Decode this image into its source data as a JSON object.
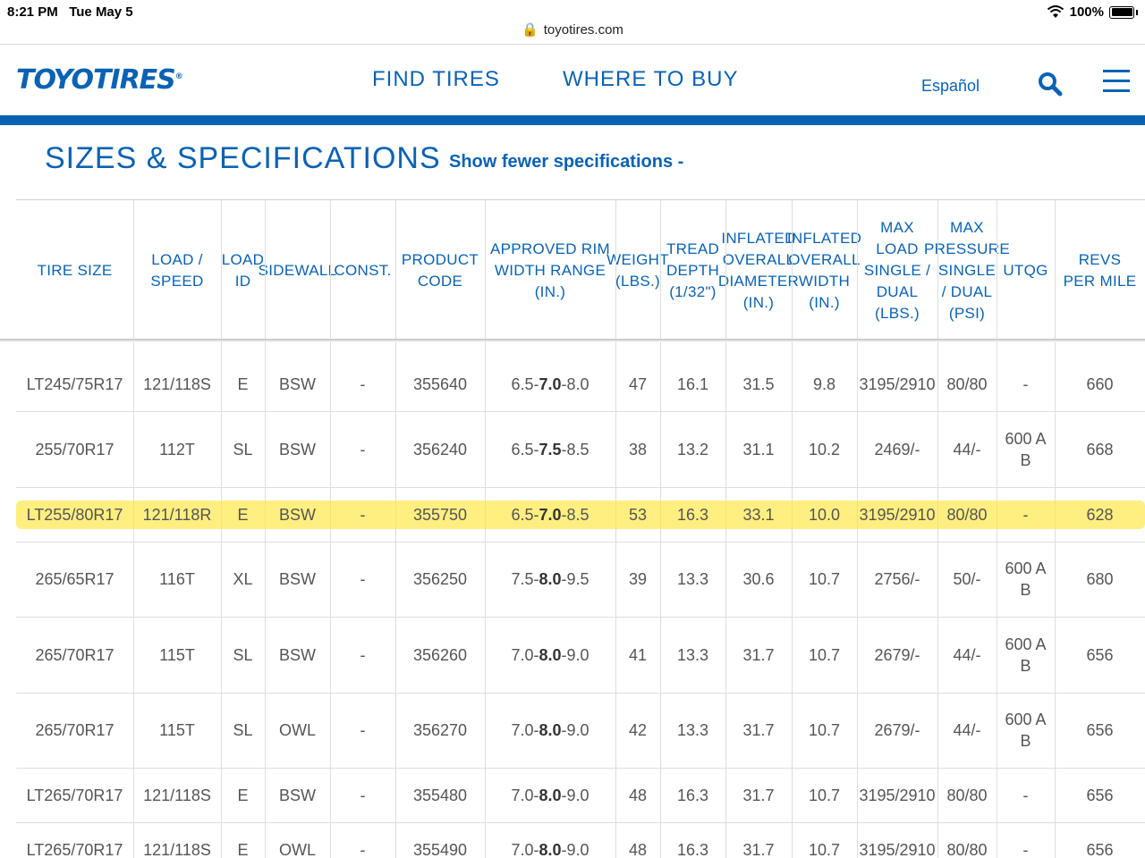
{
  "status": {
    "time": "8:21 PM",
    "date": "Tue May 5",
    "battery": "100%",
    "url": "toyotires.com"
  },
  "header": {
    "logo": "TOYOTIRES",
    "logo_mark": "®",
    "nav": [
      "FIND TIRES",
      "WHERE TO BUY"
    ],
    "espanol": "Español"
  },
  "section": {
    "title": "SIZES & SPECIFICATIONS",
    "toggle": "Show fewer specifications -"
  },
  "columns": [
    "TIRE SIZE",
    "LOAD / SPEED",
    "LOAD ID",
    "SIDEWALL",
    "CONST.",
    "PRODUCT CODE",
    "APPROVED RIM WIDTH RANGE (IN.)",
    "WEIGHT (LBS.)",
    "TREAD DEPTH (1/32\")",
    "INFLATED OVERALL DIAMETER (IN.)",
    "INFLATED OVERALL WIDTH (IN.)",
    "MAX LOAD SINGLE / DUAL (LBS.)",
    "MAX PRESSURE SINGLE / DUAL (PSI)",
    "UTQG",
    "REVS PER MILE"
  ],
  "rows": [
    {
      "size": "LT245/75R17",
      "load": "121/118S",
      "id": "E",
      "sidewall": "BSW",
      "const": "-",
      "code": "355640",
      "rim": [
        "6.5-",
        "7.0",
        "-8.0"
      ],
      "weight": "47",
      "tread": "16.1",
      "dia": "31.5",
      "width": "9.8",
      "maxload": "3195/2910",
      "psi": "80/80",
      "utqg": "-",
      "revs": "660"
    },
    {
      "size": "255/70R17",
      "load": "112T",
      "id": "SL",
      "sidewall": "BSW",
      "const": "-",
      "code": "356240",
      "rim": [
        "6.5-",
        "7.5",
        "-8.5"
      ],
      "weight": "38",
      "tread": "13.2",
      "dia": "31.1",
      "width": "10.2",
      "maxload": "2469/-",
      "psi": "44/-",
      "utqg": "600 A B",
      "revs": "668"
    },
    {
      "size": "LT255/80R17",
      "load": "121/118R",
      "id": "E",
      "sidewall": "BSW",
      "const": "-",
      "code": "355750",
      "rim": [
        "6.5-",
        "7.0",
        "-8.5"
      ],
      "weight": "53",
      "tread": "16.3",
      "dia": "33.1",
      "width": "10.0",
      "maxload": "3195/2910",
      "psi": "80/80",
      "utqg": "-",
      "revs": "628",
      "highlighted": true
    },
    {
      "size": "265/65R17",
      "load": "116T",
      "id": "XL",
      "sidewall": "BSW",
      "const": "-",
      "code": "356250",
      "rim": [
        "7.5-",
        "8.0",
        "-9.5"
      ],
      "weight": "39",
      "tread": "13.3",
      "dia": "30.6",
      "width": "10.7",
      "maxload": "2756/-",
      "psi": "50/-",
      "utqg": "600 A B",
      "revs": "680"
    },
    {
      "size": "265/70R17",
      "load": "115T",
      "id": "SL",
      "sidewall": "BSW",
      "const": "-",
      "code": "356260",
      "rim": [
        "7.0-",
        "8.0",
        "-9.0"
      ],
      "weight": "41",
      "tread": "13.3",
      "dia": "31.7",
      "width": "10.7",
      "maxload": "2679/-",
      "psi": "44/-",
      "utqg": "600 A B",
      "revs": "656"
    },
    {
      "size": "265/70R17",
      "load": "115T",
      "id": "SL",
      "sidewall": "OWL",
      "const": "-",
      "code": "356270",
      "rim": [
        "7.0-",
        "8.0",
        "-9.0"
      ],
      "weight": "42",
      "tread": "13.3",
      "dia": "31.7",
      "width": "10.7",
      "maxload": "2679/-",
      "psi": "44/-",
      "utqg": "600 A B",
      "revs": "656"
    },
    {
      "size": "LT265/70R17",
      "load": "121/118S",
      "id": "E",
      "sidewall": "BSW",
      "const": "-",
      "code": "355480",
      "rim": [
        "7.0-",
        "8.0",
        "-9.0"
      ],
      "weight": "48",
      "tread": "16.3",
      "dia": "31.7",
      "width": "10.7",
      "maxload": "3195/2910",
      "psi": "80/80",
      "utqg": "-",
      "revs": "656"
    },
    {
      "size": "LT265/70R17",
      "load": "121/118S",
      "id": "E",
      "sidewall": "OWL",
      "const": "-",
      "code": "355490",
      "rim": [
        "7.0-",
        "8.0",
        "-9.0"
      ],
      "weight": "48",
      "tread": "16.3",
      "dia": "31.7",
      "width": "10.7",
      "maxload": "3195/2910",
      "psi": "80/80",
      "utqg": "-",
      "revs": "656"
    }
  ],
  "colors": {
    "brand": "#0a62b3",
    "highlight": "#ffe63c"
  }
}
